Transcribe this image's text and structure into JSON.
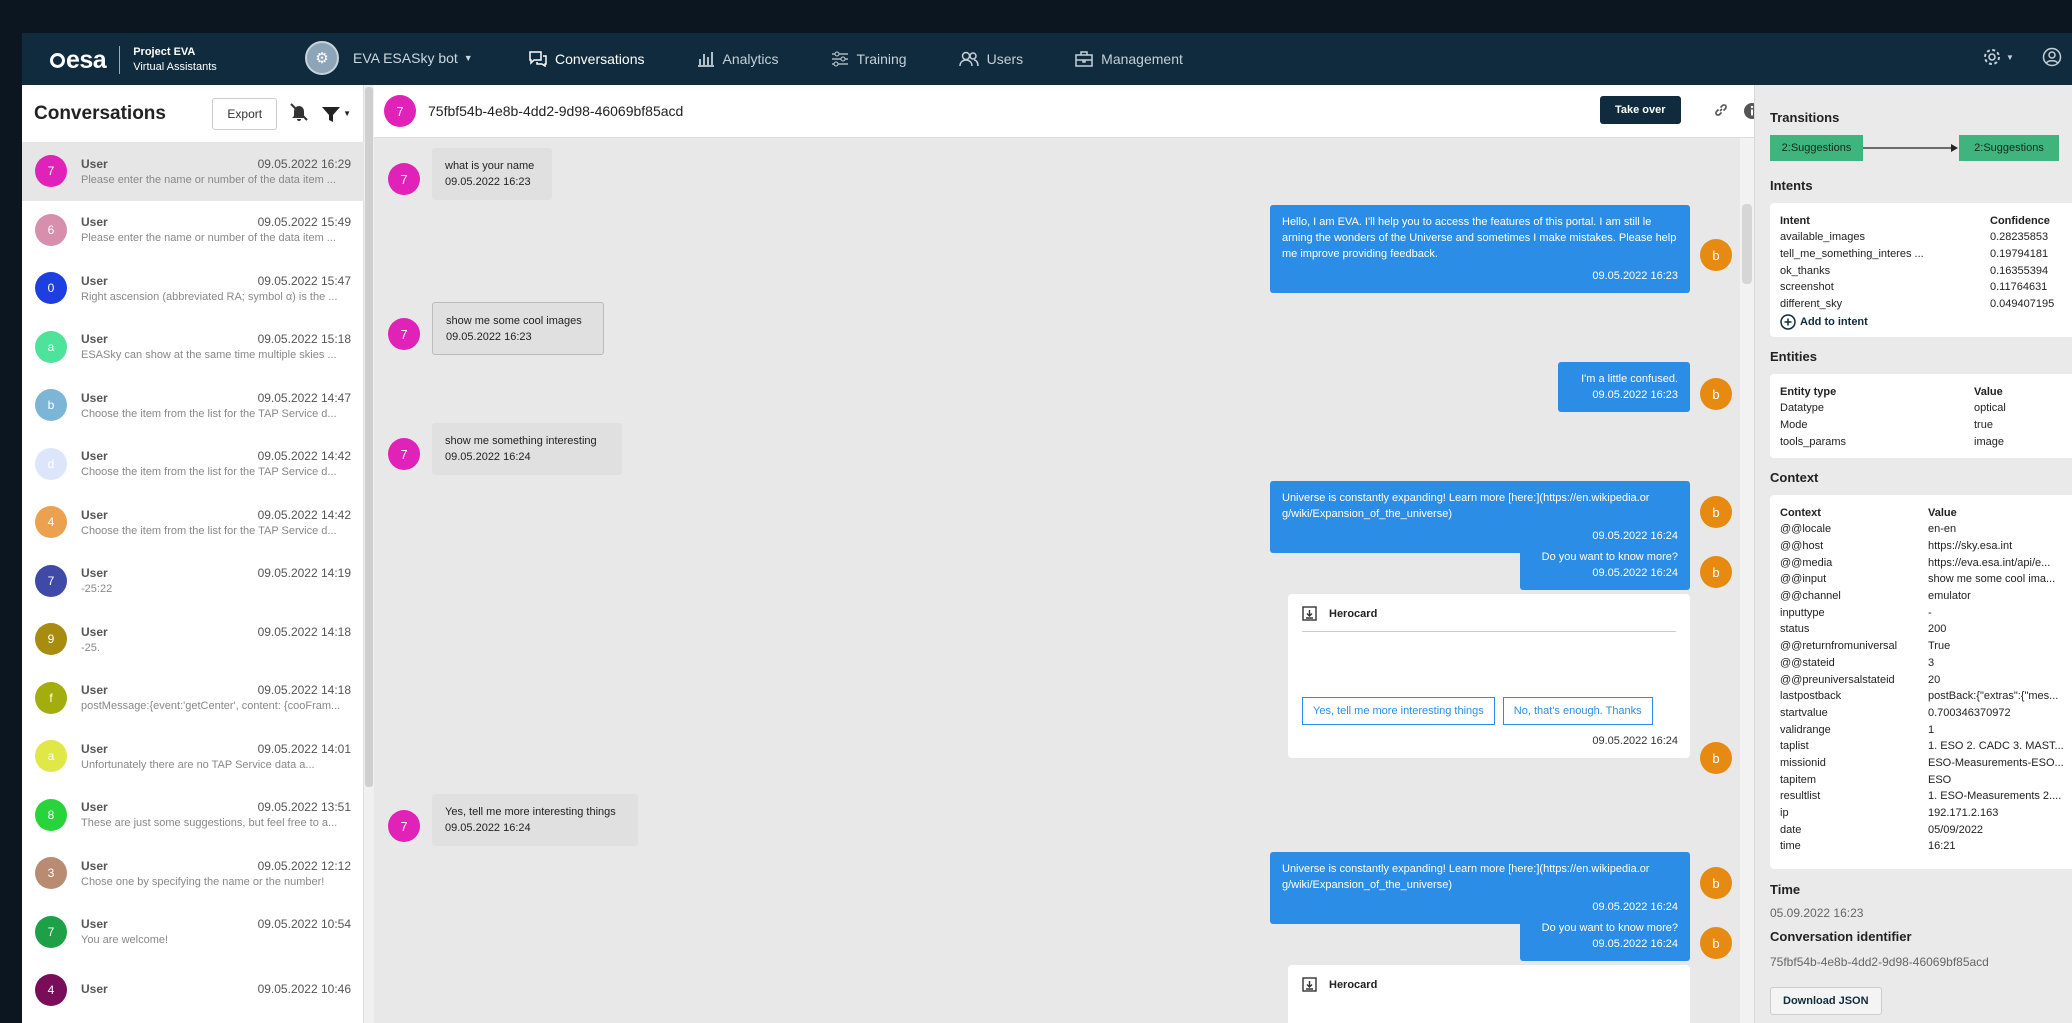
{
  "header": {
    "logo_text": "esa",
    "project_title": "Project EVA",
    "project_subtitle": "Virtual Assistants",
    "bot_name": "EVA ESASky bot",
    "nav": [
      {
        "label": "Conversations",
        "icon": "chat-icon",
        "active": true
      },
      {
        "label": "Analytics",
        "icon": "bar-chart-icon",
        "active": false
      },
      {
        "label": "Training",
        "icon": "sliders-icon",
        "active": false
      },
      {
        "label": "Users",
        "icon": "users-icon",
        "active": false
      },
      {
        "label": "Management",
        "icon": "briefcase-icon",
        "active": false
      }
    ]
  },
  "sidebar": {
    "title": "Conversations",
    "export_label": "Export",
    "conversations": [
      {
        "initial": "7",
        "color": "#e022b8",
        "name": "User",
        "date": "09.05.2022 16:29",
        "preview": "Please enter the name or number of the data item ..."
      },
      {
        "initial": "6",
        "color": "#d88fae",
        "name": "User",
        "date": "09.05.2022 15:49",
        "preview": "Please enter the name or number of the data item ..."
      },
      {
        "initial": "0",
        "color": "#1d3ee0",
        "name": "User",
        "date": "09.05.2022 15:47",
        "preview": "Right ascension (abbreviated RA; symbol α) is the ..."
      },
      {
        "initial": "a",
        "color": "#4ee39b",
        "name": "User",
        "date": "09.05.2022 15:18",
        "preview": "ESASky can show at the same time multiple skies ..."
      },
      {
        "initial": "b",
        "color": "#7db5d6",
        "name": "User",
        "date": "09.05.2022 14:47",
        "preview": "Choose the item from the list for the TAP Service d..."
      },
      {
        "initial": "d",
        "color": "#dde5fb",
        "name": "User",
        "date": "09.05.2022 14:42",
        "preview": "Choose the item from the list for the TAP Service d..."
      },
      {
        "initial": "4",
        "color": "#eba150",
        "name": "User",
        "date": "09.05.2022 14:42",
        "preview": "Choose the item from the list for the TAP Service d..."
      },
      {
        "initial": "7",
        "color": "#3f4aa8",
        "name": "User",
        "date": "09.05.2022 14:19",
        "preview": "-25:22"
      },
      {
        "initial": "9",
        "color": "#a88c10",
        "name": "User",
        "date": "09.05.2022 14:18",
        "preview": "-25."
      },
      {
        "initial": "f",
        "color": "#a3ad0c",
        "name": "User",
        "date": "09.05.2022 14:18",
        "preview": "postMessage:{event:'getCenter', content: {cooFram..."
      },
      {
        "initial": "a",
        "color": "#dfe846",
        "name": "User",
        "date": "09.05.2022 14:01",
        "preview": "Unfortunately there are no TAP Service data a..."
      },
      {
        "initial": "8",
        "color": "#29d43a",
        "name": "User",
        "date": "09.05.2022 13:51",
        "preview": "These are just some suggestions, but feel free to a..."
      },
      {
        "initial": "3",
        "color": "#b98b72",
        "name": "User",
        "date": "09.05.2022 12:12",
        "preview": "Chose one by specifying the name or the number!"
      },
      {
        "initial": "7",
        "color": "#1ea048",
        "name": "User",
        "date": "09.05.2022 10:54",
        "preview": "You are welcome!"
      },
      {
        "initial": "4",
        "color": "#7a0d5a",
        "name": "User",
        "date": "09.05.2022 10:46",
        "preview": ""
      }
    ]
  },
  "chat": {
    "conversation_id": "75fbf54b-4e8b-4dd2-9d98-46069bf85acd",
    "user_initial": "7",
    "bot_initial": "b",
    "take_over_label": "Take over",
    "messages": [
      {
        "text": "what is your name",
        "time": "09.05.2022 16:23"
      },
      {
        "text": "Hello, I am EVA. I'll help you to access the features of this portal. I am still le arning the wonders of the Universe and sometimes I make mistakes. Please help me improve providing feedback.",
        "time": "09.05.2022 16:23"
      },
      {
        "text": "show me some cool images",
        "time": "09.05.2022 16:23"
      },
      {
        "text": "I'm a little confused.",
        "time": "09.05.2022 16:23"
      },
      {
        "text": "show me something interesting",
        "time": "09.05.2022 16:24"
      },
      {
        "text": "Universe is constantly expanding! Learn more [here:](https://en.wikipedia.or g/wiki/Expansion_of_the_universe)",
        "time": "09.05.2022 16:24"
      },
      {
        "text": "Do you want to know more?",
        "time": "09.05.2022 16:24"
      },
      {
        "title": "Herocard",
        "button1": "Yes, tell me more interesting things",
        "button2": "No, that's enough. Thanks",
        "time": "09.05.2022 16:24"
      },
      {
        "text": "Yes, tell me more interesting things",
        "time": "09.05.2022 16:24"
      },
      {
        "text": "Universe is constantly expanding! Learn more [here:](https://en.wikipedia.or g/wiki/Expansion_of_the_universe)",
        "time": "09.05.2022 16:24"
      },
      {
        "text": "Do you want to know more?",
        "time": "09.05.2022 16:24"
      },
      {
        "title": "Herocard"
      }
    ]
  },
  "details": {
    "transitions_title": "Transitions",
    "transition_from": "2:Suggestions",
    "transition_to": "2:Suggestions",
    "intents_title": "Intents",
    "intents_header": [
      "Intent",
      "Confidence"
    ],
    "intents": [
      [
        "available_images",
        "0.28235853"
      ],
      [
        "tell_me_something_interes ...",
        "0.19794181"
      ],
      [
        "ok_thanks",
        "0.16355394"
      ],
      [
        "screenshot",
        "0.11764631"
      ],
      [
        "different_sky",
        "0.049407195"
      ]
    ],
    "add_intent_label": "Add to intent",
    "entities_title": "Entities",
    "entities_header": [
      "Entity type",
      "Value"
    ],
    "entities": [
      [
        "Datatype",
        "optical"
      ],
      [
        "Mode",
        "true"
      ],
      [
        "tools_params",
        "image"
      ]
    ],
    "context_title": "Context",
    "context_header": [
      "Context",
      "Value"
    ],
    "context": [
      [
        "@@locale",
        "en-en"
      ],
      [
        "@@host",
        "https://sky.esa.int"
      ],
      [
        "@@media",
        "https://eva.esa.int/api/e..."
      ],
      [
        "@@input",
        "show me some cool ima..."
      ],
      [
        "@@channel",
        "emulator"
      ],
      [
        "inputtype",
        "-"
      ],
      [
        "status",
        "200"
      ],
      [
        "@@returnfromuniversal",
        "True"
      ],
      [
        "@@stateid",
        "3"
      ],
      [
        "@@preuniversalstateid",
        "20"
      ],
      [
        "lastpostback",
        "postBack:{\"extras\":{\"mes..."
      ],
      [
        "startvalue",
        "0.700346370972"
      ],
      [
        "validrange",
        "1"
      ],
      [
        "taplist",
        "1. ESO 2. CADC 3. MAST..."
      ],
      [
        "missionid",
        "ESO-Measurements-ESO..."
      ],
      [
        "tapitem",
        "ESO"
      ],
      [
        "resultlist",
        "1. ESO-Measurements 2...."
      ],
      [
        "ip",
        "192.171.2.163"
      ],
      [
        "date",
        "05/09/2022"
      ],
      [
        "time",
        "16:21"
      ]
    ],
    "time_title": "Time",
    "time_value": "05.09.2022 16:23",
    "conv_id_title": "Conversation identifier",
    "conv_id_value": "75fbf54b-4e8b-4dd2-9d98-46069bf85acd",
    "download_label": "Download JSON"
  }
}
